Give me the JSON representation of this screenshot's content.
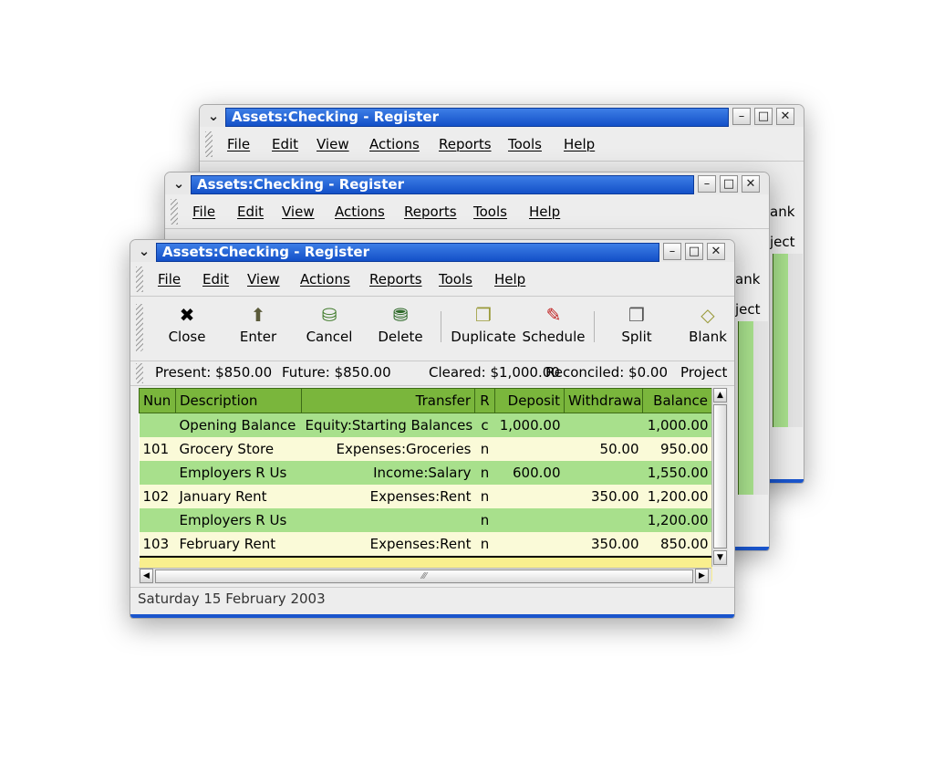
{
  "window": {
    "title": "Assets:Checking - Register",
    "menu": [
      "File",
      "Edit",
      "View",
      "Actions",
      "Reports",
      "Tools",
      "Help"
    ],
    "controls": {
      "menu": "⌄",
      "minimize": "–",
      "maximize": "□",
      "close": "✕"
    }
  },
  "toolbar": {
    "buttons": [
      {
        "label": "Close",
        "icon": "close-icon",
        "glyph": "✖"
      },
      {
        "label": "Enter",
        "icon": "enter-icon",
        "glyph": "⬆"
      },
      {
        "label": "Cancel",
        "icon": "cancel-icon",
        "glyph": "⛁"
      },
      {
        "label": "Delete",
        "icon": "delete-icon",
        "glyph": "⛃"
      },
      {
        "label": "Duplicate",
        "icon": "duplicate-icon",
        "glyph": "❐"
      },
      {
        "label": "Schedule",
        "icon": "schedule-icon",
        "glyph": "✎"
      },
      {
        "label": "Split",
        "icon": "split-icon",
        "glyph": "❒"
      },
      {
        "label": "Blank",
        "icon": "blank-icon",
        "glyph": "◇"
      }
    ]
  },
  "summary": {
    "present": "Present: $850.00",
    "future": "Future: $850.00",
    "cleared": "Cleared: $1,000.00",
    "reconciled": "Reconciled: $0.00",
    "projected": "Project"
  },
  "register": {
    "columns": [
      "Nun",
      "Description",
      "Transfer",
      "R",
      "Deposit",
      "Withdrawal",
      "Balance"
    ],
    "rows": [
      {
        "num": "",
        "desc": "Opening Balance",
        "transfer": "Equity:Starting Balances",
        "r": "c",
        "deposit": "1,000.00",
        "withdrawal": "",
        "balance": "1,000.00"
      },
      {
        "num": "101",
        "desc": "Grocery Store",
        "transfer": "Expenses:Groceries",
        "r": "n",
        "deposit": "",
        "withdrawal": "50.00",
        "balance": "950.00"
      },
      {
        "num": "",
        "desc": "Employers R Us",
        "transfer": "Income:Salary",
        "r": "n",
        "deposit": "600.00",
        "withdrawal": "",
        "balance": "1,550.00"
      },
      {
        "num": "102",
        "desc": "January Rent",
        "transfer": "Expenses:Rent",
        "r": "n",
        "deposit": "",
        "withdrawal": "350.00",
        "balance": "1,200.00"
      },
      {
        "num": "",
        "desc": "Employers R Us",
        "transfer": "",
        "r": "n",
        "deposit": "",
        "withdrawal": "",
        "balance": "1,200.00"
      },
      {
        "num": "103",
        "desc": "February Rent",
        "transfer": "Expenses:Rent",
        "r": "n",
        "deposit": "",
        "withdrawal": "350.00",
        "balance": "850.00"
      }
    ]
  },
  "status": "Saturday 15 February 2003",
  "back_windows": {
    "fragments": [
      "ank",
      "ject"
    ]
  },
  "colors": {
    "title_bar": "#1350c8",
    "header": "#7ab63c",
    "row_green": "#a8e08c",
    "row_yellow": "#fafad8"
  }
}
